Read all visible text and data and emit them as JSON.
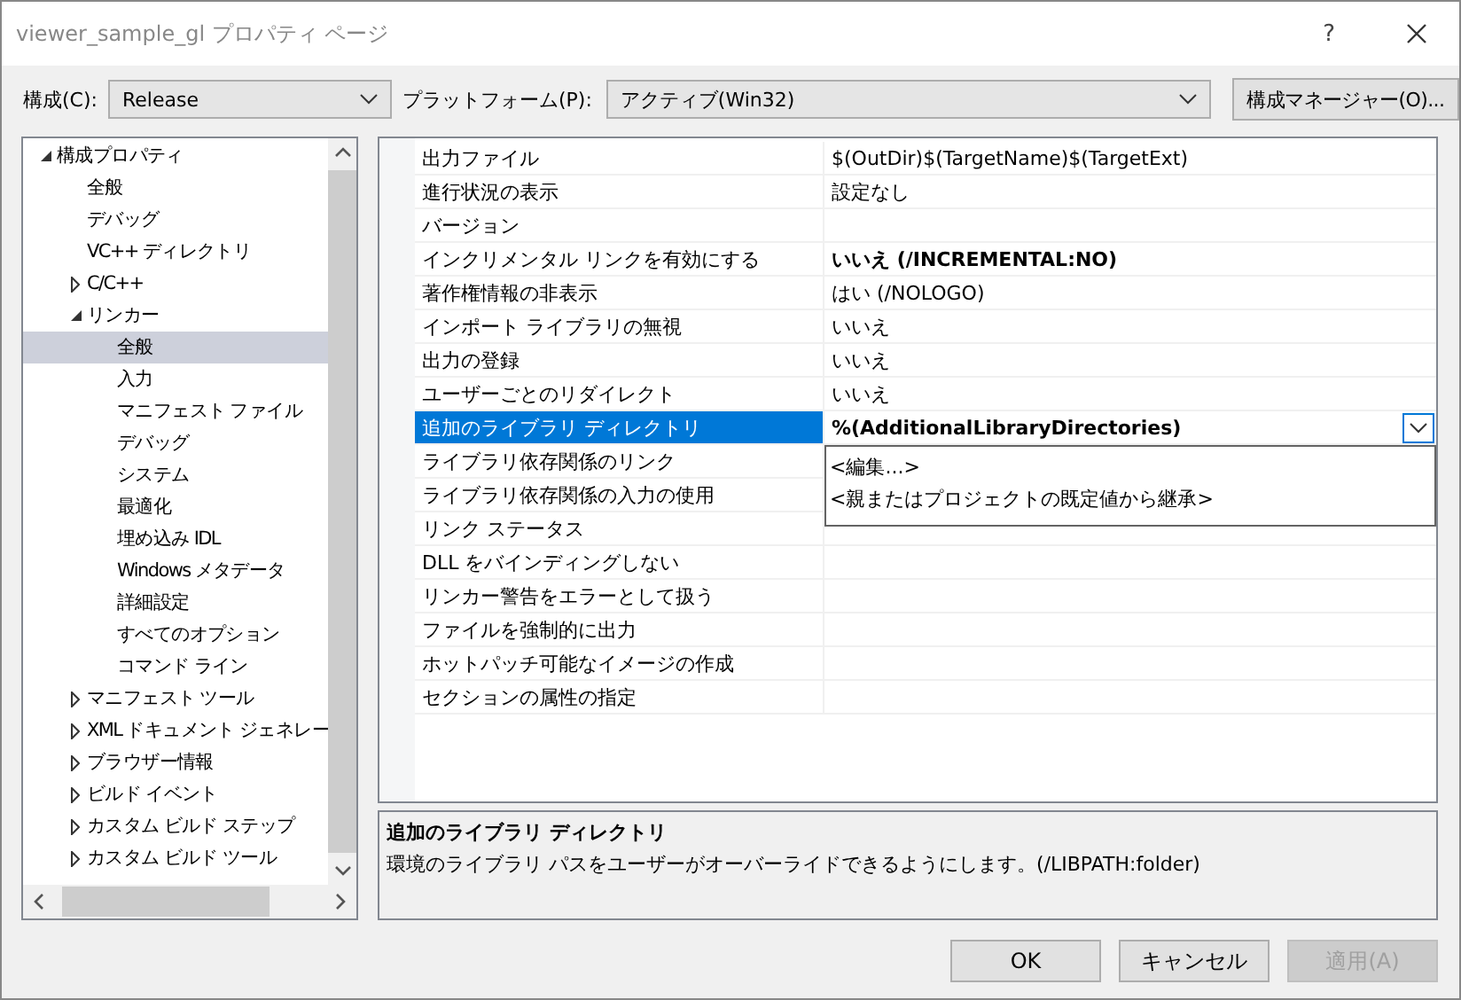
{
  "window": {
    "title": "viewer_sample_gl プロパティ ページ",
    "help": "?"
  },
  "toolbar": {
    "configuration_label": "構成(C):",
    "configuration": "Release",
    "platform_label": "プラットフォーム(P):",
    "platform": "アクティブ(Win32)",
    "manager_button": "構成マネージャー(O)..."
  },
  "tree": [
    {
      "label": "構成プロパティ",
      "expanded": true,
      "selected": false,
      "children": [
        {
          "label": "全般",
          "selected": false
        },
        {
          "label": "デバッグ",
          "selected": false
        },
        {
          "label": "VC++ ディレクトリ",
          "selected": false
        },
        {
          "label": "C/C++",
          "expanded": false,
          "selected": false
        },
        {
          "label": "リンカー",
          "expanded": true,
          "selected": false,
          "children": [
            {
              "label": "全般",
              "selected": true
            },
            {
              "label": "入力",
              "selected": false
            },
            {
              "label": "マニフェスト ファイル",
              "selected": false
            },
            {
              "label": "デバッグ",
              "selected": false
            },
            {
              "label": "システム",
              "selected": false
            },
            {
              "label": "最適化",
              "selected": false
            },
            {
              "label": "埋め込み IDL",
              "selected": false
            },
            {
              "label": "Windows メタデータ",
              "selected": false
            },
            {
              "label": "詳細設定",
              "selected": false
            },
            {
              "label": "すべてのオプション",
              "selected": false
            },
            {
              "label": "コマンド ライン",
              "selected": false
            }
          ]
        },
        {
          "label": "マニフェスト ツール",
          "expanded": false,
          "selected": false
        },
        {
          "label": "XML ドキュメント ジェネレー",
          "expanded": false,
          "selected": false
        },
        {
          "label": "ブラウザー情報",
          "expanded": false,
          "selected": false
        },
        {
          "label": "ビルド イベント",
          "expanded": false,
          "selected": false
        },
        {
          "label": "カスタム ビルド ステップ",
          "expanded": false,
          "selected": false
        },
        {
          "label": "カスタム ビルド ツール",
          "expanded": false,
          "selected": false
        }
      ]
    }
  ],
  "grid": {
    "rows": [
      {
        "name": "出力ファイル",
        "value": "$(OutDir)$(TargetName)$(TargetExt)",
        "bold": false,
        "selected": false
      },
      {
        "name": "進行状況の表示",
        "value": "設定なし",
        "bold": false,
        "selected": false
      },
      {
        "name": "バージョン",
        "selected": false
      },
      {
        "name": "インクリメンタル リンクを有効にする",
        "value": "いいえ (/INCREMENTAL:NO)",
        "bold": true,
        "selected": false
      },
      {
        "name": "著作権情報の非表示",
        "value": "はい (/NOLOGO)",
        "bold": false,
        "selected": false
      },
      {
        "name": "インポート ライブラリの無視",
        "value": "いいえ",
        "bold": false,
        "selected": false
      },
      {
        "name": "出力の登録",
        "value": "いいえ",
        "bold": false,
        "selected": false
      },
      {
        "name": "ユーザーごとのリダイレクト",
        "value": "いいえ",
        "bold": false,
        "selected": false
      },
      {
        "name": "追加のライブラリ ディレクトリ",
        "value": "%(AdditionalLibraryDirectories)",
        "bold": true,
        "selected": true
      },
      {
        "name": "ライブラリ依存関係のリンク",
        "selected": false
      },
      {
        "name": "ライブラリ依存関係の入力の使用",
        "selected": false
      },
      {
        "name": "リンク ステータス",
        "selected": false
      },
      {
        "name": "DLL をバインディングしない",
        "selected": false
      },
      {
        "name": "リンカー警告をエラーとして扱う",
        "selected": false
      },
      {
        "name": "ファイルを強制的に出力",
        "selected": false
      },
      {
        "name": "ホットパッチ可能なイメージの作成",
        "selected": false
      },
      {
        "name": "セクションの属性の指定",
        "selected": false
      }
    ],
    "dropdown": {
      "options": [
        "<編集...>",
        "<親またはプロジェクトの既定値から継承>"
      ]
    }
  },
  "description": {
    "title": "追加のライブラリ ディレクトリ",
    "text": "環境のライブラリ パスをユーザーがオーバーライドできるようにします。(/LIBPATH:folder)"
  },
  "buttons": [
    {
      "label": "OK",
      "disabled": false
    },
    {
      "label": "キャンセル",
      "disabled": false
    },
    {
      "label": "適用(A)",
      "disabled": true
    }
  ]
}
